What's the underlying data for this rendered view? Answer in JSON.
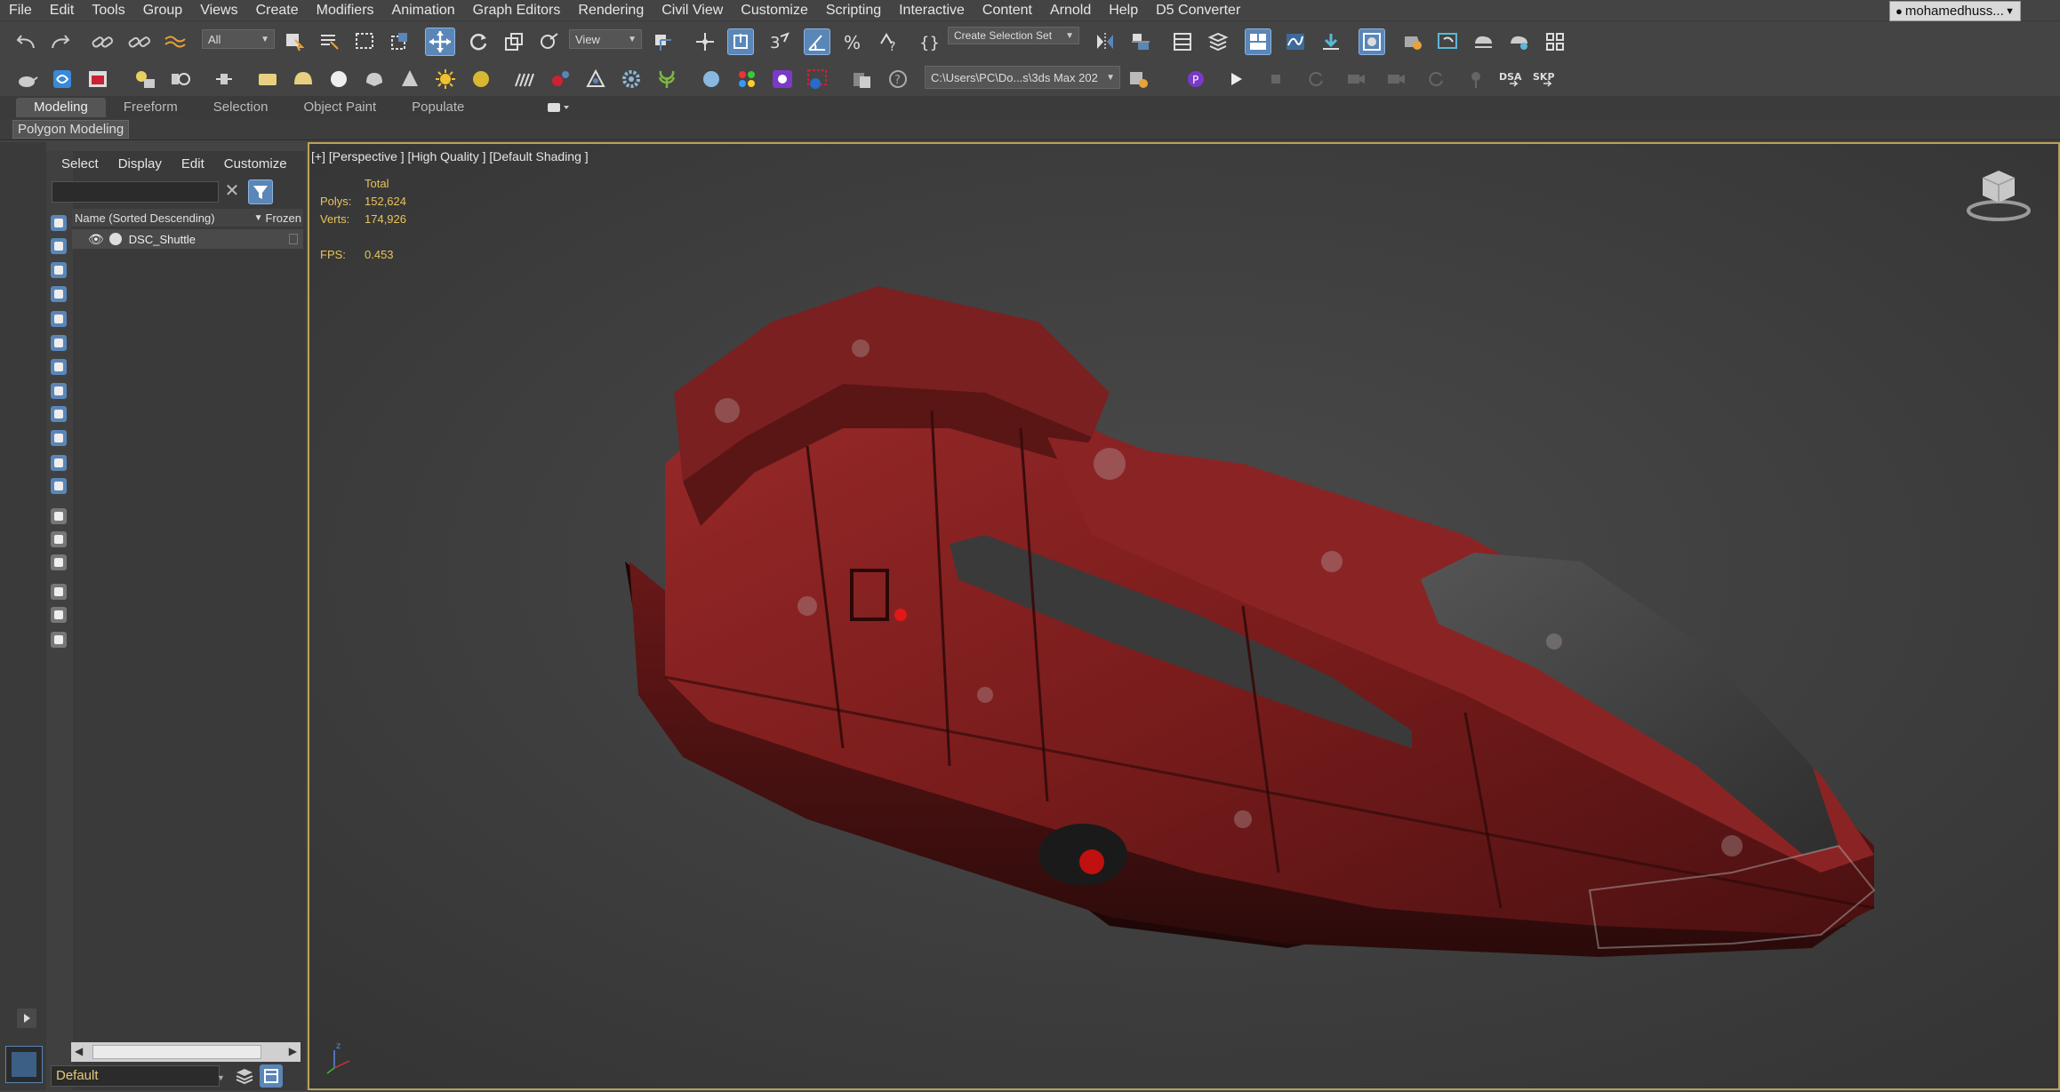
{
  "menu": [
    "File",
    "Edit",
    "Tools",
    "Group",
    "Views",
    "Create",
    "Modifiers",
    "Animation",
    "Graph Editors",
    "Rendering",
    "Civil View",
    "Customize",
    "Scripting",
    "Interactive",
    "Content",
    "Arnold",
    "Help",
    "D5 Converter"
  ],
  "user": {
    "name": "mohamedhuss..."
  },
  "toolbar1": {
    "selection_filter": "All",
    "ref_coord": "View",
    "selection_set_placeholder": "Create Selection Set"
  },
  "toolbar2": {
    "project_path": "C:\\Users\\PC\\Do...s\\3ds Max 202",
    "dsa_label": "DSA",
    "skp_label": "SKP"
  },
  "ribbon": {
    "tabs": [
      "Modeling",
      "Freeform",
      "Selection",
      "Object Paint",
      "Populate"
    ],
    "active_tab": "Modeling",
    "panel_label": "Polygon Modeling"
  },
  "scene_explorer": {
    "menu": [
      "Select",
      "Display",
      "Edit",
      "Customize"
    ],
    "column_name": "Name (Sorted Descending)",
    "column_frozen": "Frozen",
    "rows": [
      {
        "name": "DSC_Shuttle"
      }
    ],
    "layer": "Default"
  },
  "viewport": {
    "label": "[+] [Perspective ] [High Quality ] [Default Shading ]",
    "stats": {
      "header": "Total",
      "polys_label": "Polys:",
      "polys_value": "152,624",
      "verts_label": "Verts:",
      "verts_value": "174,926",
      "fps_label": "FPS:",
      "fps_value": "0.453"
    }
  },
  "colors": {
    "accent": "#5a86b8",
    "viewport_border": "#b9a25a",
    "stats_text": "#e8c45a",
    "hull": "#8a2222"
  }
}
